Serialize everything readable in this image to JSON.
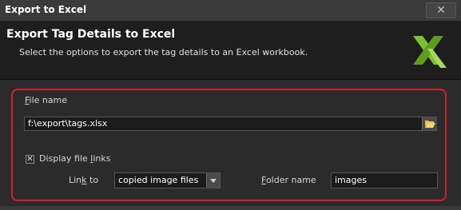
{
  "window": {
    "title": "Export to Excel",
    "close_glyph": "✕",
    "close_icon": "close-icon"
  },
  "header": {
    "title": "Export Tag Details to Excel",
    "description": "Select the options to export the tag details to an Excel workbook.",
    "logo_icon": "excel-x-icon",
    "logo_color": "#7bc22e"
  },
  "options": {
    "highlight_color": "#d51f2b",
    "file_name": {
      "label_accel": "F",
      "label_rest": "ile name",
      "value": "f:\\export\\tags.xlsx",
      "browse_icon": "folder-open-icon"
    },
    "display_links": {
      "checked": true,
      "check_glyph": "✕",
      "label_pre": "Display file ",
      "label_accel": "l",
      "label_post": "inks"
    },
    "link_to": {
      "label_pre": "Lin",
      "label_accel": "k",
      "label_post": " to",
      "selected": "copied image files",
      "arrow_icon": "dropdown-arrow-icon"
    },
    "folder_name": {
      "label_accel": "F",
      "label_rest": "older name",
      "value": "images"
    }
  }
}
